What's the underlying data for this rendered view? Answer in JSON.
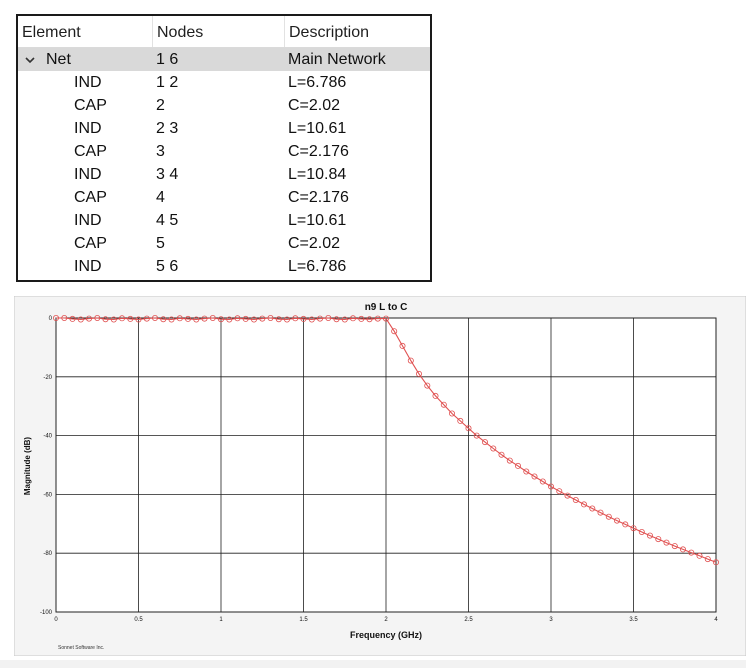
{
  "table": {
    "columns": [
      "Element",
      "Nodes",
      "Description"
    ],
    "rows": [
      {
        "element": "Net",
        "nodes": "1 6",
        "description": "Main Network",
        "expanded": true,
        "selected": true,
        "level": 0
      },
      {
        "element": "IND",
        "nodes": "1 2",
        "description": "L=6.786",
        "level": 1
      },
      {
        "element": "CAP",
        "nodes": "2",
        "description": "C=2.02",
        "level": 1
      },
      {
        "element": "IND",
        "nodes": "2 3",
        "description": "L=10.61",
        "level": 1
      },
      {
        "element": "CAP",
        "nodes": "3",
        "description": "C=2.176",
        "level": 1
      },
      {
        "element": "IND",
        "nodes": "3 4",
        "description": "L=10.84",
        "level": 1
      },
      {
        "element": "CAP",
        "nodes": "4",
        "description": "C=2.176",
        "level": 1
      },
      {
        "element": "IND",
        "nodes": "4 5",
        "description": "L=10.61",
        "level": 1
      },
      {
        "element": "CAP",
        "nodes": "5",
        "description": "C=2.02",
        "level": 1
      },
      {
        "element": "IND",
        "nodes": "5 6",
        "description": "L=6.786",
        "level": 1
      }
    ]
  },
  "chart_data": {
    "type": "line",
    "title": "n9 L to C",
    "xlabel": "Frequency (GHz)",
    "ylabel": "Magnitude (dB)",
    "xlim": [
      0,
      4
    ],
    "ylim": [
      -100,
      0
    ],
    "xticks": [
      0,
      0.5,
      1,
      1.5,
      2,
      2.5,
      3,
      3.5,
      4
    ],
    "xtick_labels": [
      "0",
      "0.5",
      "1",
      "1.5",
      "2",
      "2.5",
      "3",
      "3.5",
      "4"
    ],
    "yticks": [
      0,
      -20,
      -40,
      -60,
      -80,
      -100
    ],
    "ytick_labels": [
      "0",
      "-20",
      "-40",
      "-60",
      "-80",
      "-100"
    ],
    "grid": true,
    "line_color": "#e05050",
    "marker": "circle",
    "series": [
      {
        "x": [
          0.0,
          0.05,
          0.1,
          0.15,
          0.2,
          0.25,
          0.3,
          0.35,
          0.4,
          0.45,
          0.5,
          0.55,
          0.6,
          0.65,
          0.7,
          0.75,
          0.8,
          0.85,
          0.9,
          0.95,
          1.0,
          1.05,
          1.1,
          1.15,
          1.2,
          1.25,
          1.3,
          1.35,
          1.4,
          1.45,
          1.5,
          1.55,
          1.6,
          1.65,
          1.7,
          1.75,
          1.8,
          1.85,
          1.9,
          1.95,
          2.0,
          2.05,
          2.1,
          2.15,
          2.2,
          2.25,
          2.3,
          2.35,
          2.4,
          2.45,
          2.5,
          2.55,
          2.6,
          2.65,
          2.7,
          2.75,
          2.8,
          2.85,
          2.9,
          2.95,
          3.0,
          3.05,
          3.1,
          3.15,
          3.2,
          3.25,
          3.3,
          3.35,
          3.4,
          3.45,
          3.5,
          3.55,
          3.6,
          3.65,
          3.7,
          3.75,
          3.8,
          3.85,
          3.9,
          3.95,
          4.0
        ],
        "y": [
          0.0,
          0.0,
          -0.3,
          -0.5,
          -0.2,
          0.0,
          -0.4,
          -0.5,
          -0.1,
          -0.3,
          -0.5,
          -0.2,
          0.0,
          -0.4,
          -0.5,
          -0.1,
          -0.3,
          -0.5,
          -0.2,
          0.0,
          -0.4,
          -0.5,
          -0.1,
          -0.3,
          -0.5,
          -0.2,
          0.0,
          -0.4,
          -0.5,
          -0.1,
          -0.3,
          -0.5,
          -0.2,
          0.0,
          -0.4,
          -0.5,
          -0.1,
          -0.3,
          -0.4,
          -0.2,
          -0.2,
          -4.5,
          -9.5,
          -14.5,
          -19.0,
          -23.0,
          -26.5,
          -29.5,
          -32.5,
          -35.0,
          -37.5,
          -40.0,
          -42.2,
          -44.4,
          -46.5,
          -48.5,
          -50.3,
          -52.2,
          -53.9,
          -55.6,
          -57.3,
          -58.9,
          -60.4,
          -61.9,
          -63.4,
          -64.8,
          -66.2,
          -67.6,
          -68.9,
          -70.2,
          -71.5,
          -72.8,
          -74.0,
          -75.2,
          -76.4,
          -77.6,
          -78.7,
          -79.8,
          -80.9,
          -82.0,
          -83.1
        ]
      }
    ]
  },
  "footer": {
    "credit": "Sonnet Software Inc."
  }
}
